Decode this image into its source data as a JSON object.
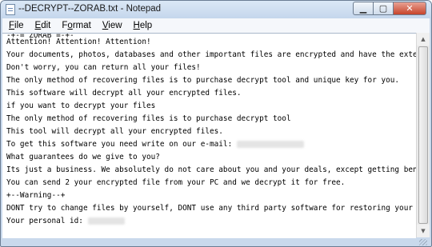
{
  "window": {
    "title": "--DECRYPT--ZORAB.txt - Notepad",
    "caption_buttons": {
      "minimize": "▁",
      "maximize": "▢",
      "close": "✕"
    }
  },
  "menu": [
    {
      "label": "File",
      "accel": "F",
      "rest": "ile"
    },
    {
      "label": "Edit",
      "accel": "E",
      "rest": "dit"
    },
    {
      "label": "Format",
      "accel": "o",
      "pre": "F",
      "rest": "rmat"
    },
    {
      "label": "View",
      "accel": "V",
      "rest": "iew"
    },
    {
      "label": "Help",
      "accel": "H",
      "rest": "elp"
    }
  ],
  "document": {
    "lines": [
      "-+-= ZORAB =-+-",
      "Attention! Attention! Attention!",
      "Your documents, photos, databases and other important files are encrypted and have the extension: .ZRB",
      "Don't worry, you can return all your files!",
      "The only method of recovering files is to purchase decrypt tool and unique key for you.",
      "This software will decrypt all your encrypted files.",
      "if you want to decrypt your files",
      "The only method of recovering files is to purchase decrypt tool",
      "This tool will decrypt all your encrypted files.",
      "To get this software you need write on our e-mail: ",
      "What guarantees do we give to you?",
      "Its just a business. We absolutely do not care about you and your deals, except getting benefits.",
      "You can send 2 your encrypted file from your PC and we decrypt it for free.",
      "+--Warning--+",
      "DONT try to change files by yourself, DONT use any third party software for restoring your data",
      "Your personal id: "
    ]
  },
  "colors": {
    "titlebar": "#c4d6ec",
    "close_button": "#c7442b",
    "editor_bg": "#ffffff"
  }
}
